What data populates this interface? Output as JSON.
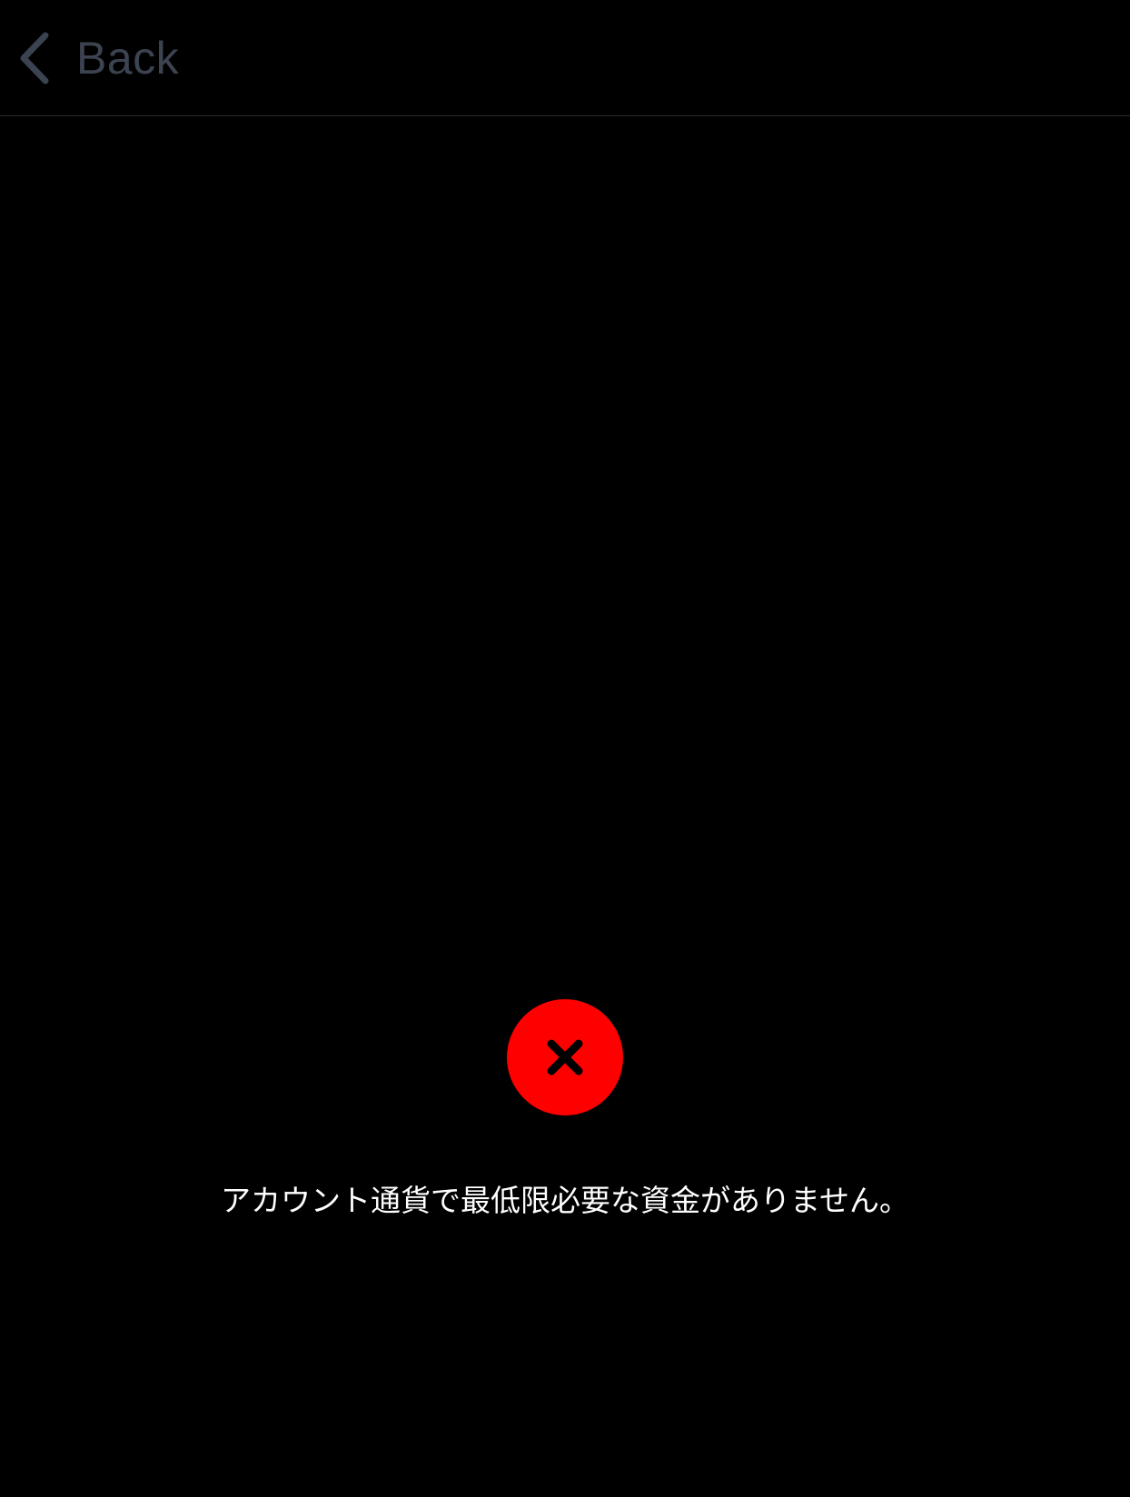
{
  "nav": {
    "back_label": "Back",
    "back_icon": "chevron-left-icon"
  },
  "status": {
    "icon": "close-icon",
    "badge_color": "#ff0000",
    "message": "アカウント通貨で最低限必要な資金がありません。"
  },
  "colors": {
    "background": "#000000",
    "nav_text": "#3c4350",
    "divider": "#2a2c30",
    "error": "#ff0000",
    "message_text": "#ffffff"
  }
}
